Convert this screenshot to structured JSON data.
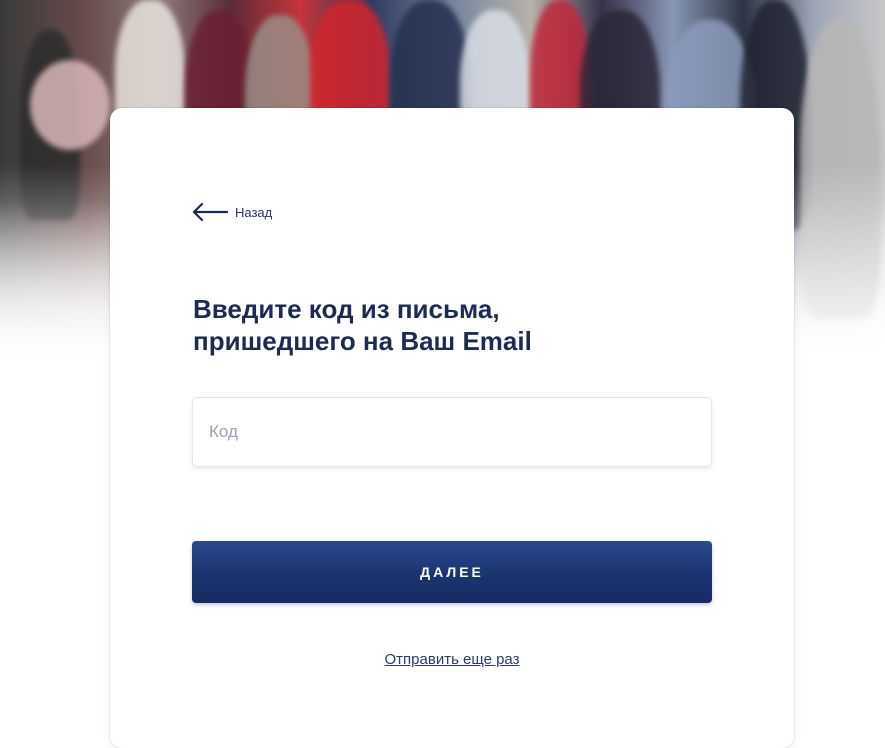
{
  "back": {
    "label": "Назад",
    "icon": "arrow-left-icon"
  },
  "title": {
    "line1": "Введите код из письма,",
    "line2": "пришедшего на Ваш Email"
  },
  "code_input": {
    "placeholder": "Код",
    "value": ""
  },
  "next_button": {
    "label": "ДАЛЕЕ"
  },
  "resend_link": {
    "label": "Отправить еще раз"
  },
  "colors": {
    "accent": "#1b3470",
    "title": "#1d2a55",
    "card_background": "#ffffff"
  }
}
